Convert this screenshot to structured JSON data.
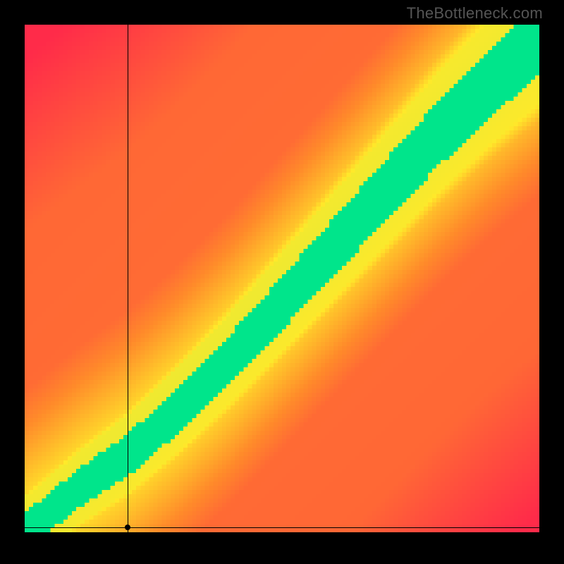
{
  "watermark": "TheBottleneck.com",
  "chart_data": {
    "type": "heatmap",
    "title": "",
    "xlabel": "",
    "ylabel": "",
    "xlim": [
      0,
      100
    ],
    "ylim": [
      0,
      100
    ],
    "grid": false,
    "legend": false,
    "colorscale": [
      {
        "stop": 0.0,
        "color": "#ff2b49",
        "meaning": "severe bottleneck"
      },
      {
        "stop": 0.4,
        "color": "#ff8a2a",
        "meaning": "moderate bottleneck"
      },
      {
        "stop": 0.7,
        "color": "#ffe92a",
        "meaning": "mild bottleneck"
      },
      {
        "stop": 1.0,
        "color": "#00e58b",
        "meaning": "balanced"
      }
    ],
    "optimal_band": {
      "description": "green diagonal band where components are balanced; y ≈ f(x) with slight curvature near origin",
      "sample_points_xy": [
        [
          0,
          0
        ],
        [
          10,
          8
        ],
        [
          20,
          15
        ],
        [
          30,
          24
        ],
        [
          40,
          34
        ],
        [
          50,
          45
        ],
        [
          60,
          56
        ],
        [
          70,
          67
        ],
        [
          80,
          78
        ],
        [
          90,
          88
        ],
        [
          100,
          97
        ]
      ],
      "band_half_width_percent": 6
    },
    "guides": {
      "vertical_line_x": 20,
      "horizontal_line_y": 1,
      "marker_xy": [
        20,
        1
      ]
    },
    "resolution_cells": 120
  }
}
